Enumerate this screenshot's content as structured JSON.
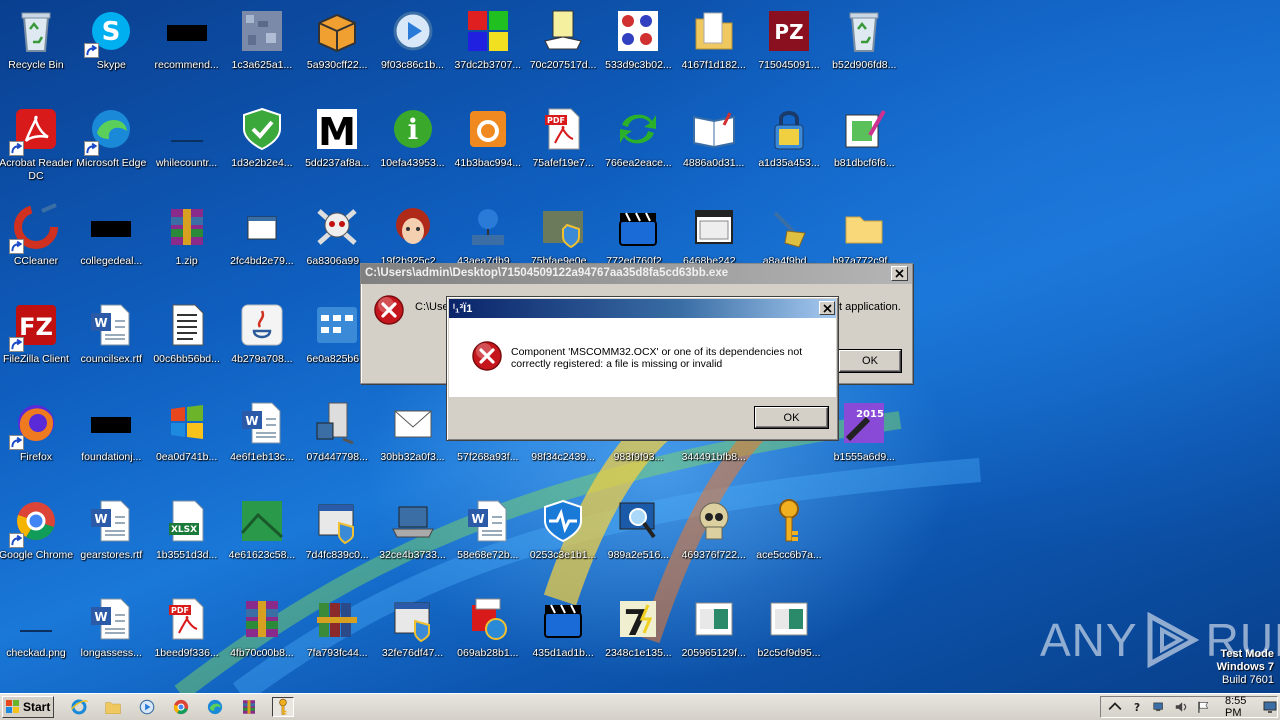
{
  "desktop": {
    "icons": [
      {
        "label": "Recycle Bin",
        "icon": "recycle-bin-icon",
        "shortcut": false
      },
      {
        "label": "Skype",
        "icon": "skype-icon",
        "shortcut": true
      },
      {
        "label": "recommend...",
        "icon": "black-file-icon",
        "shortcut": false
      },
      {
        "label": "1c3a625a1...",
        "icon": "noise-image-icon",
        "shortcut": false
      },
      {
        "label": "5a930cff22...",
        "icon": "package-box-icon",
        "shortcut": false
      },
      {
        "label": "9f03c86c1b...",
        "icon": "media-player-icon",
        "shortcut": false
      },
      {
        "label": "37dc2b3707...",
        "icon": "color-squares-icon",
        "shortcut": false
      },
      {
        "label": "70c207517d...",
        "icon": "clipboard-hand-icon",
        "shortcut": false
      },
      {
        "label": "533d9c3b02...",
        "icon": "pattern-icon",
        "shortcut": false
      },
      {
        "label": "4167f1d182...",
        "icon": "folder-icon",
        "shortcut": false
      },
      {
        "label": "715045091...",
        "icon": "pz-logo-icon",
        "shortcut": false
      },
      {
        "label": "b52d906fd8...",
        "icon": "recycle-bin-icon",
        "shortcut": false
      },
      {
        "label": "Acrobat Reader DC",
        "icon": "acrobat-icon",
        "shortcut": true
      },
      {
        "label": "Microsoft Edge",
        "icon": "edge-icon",
        "shortcut": true
      },
      {
        "label": "whilecountr...",
        "icon": "blue-file-icon",
        "shortcut": false
      },
      {
        "label": "1d3e2b2e4...",
        "icon": "shield-check-icon",
        "shortcut": false
      },
      {
        "label": "5dd237af8a...",
        "icon": "black-m-icon",
        "shortcut": false
      },
      {
        "label": "10efa43953...",
        "icon": "info-icon",
        "shortcut": false
      },
      {
        "label": "41b3bac994...",
        "icon": "orange-box-icon",
        "shortcut": false
      },
      {
        "label": "75afef19e7...",
        "icon": "pdf-icon",
        "shortcut": false
      },
      {
        "label": "766ea2eace...",
        "icon": "green-arrows-icon",
        "shortcut": false
      },
      {
        "label": "4886a0d31...",
        "icon": "open-book-icon",
        "shortcut": false
      },
      {
        "label": "a1d35a453...",
        "icon": "lock-icon",
        "shortcut": false
      },
      {
        "label": "b81dbcf6f6...",
        "icon": "picture-edit-icon",
        "shortcut": false
      },
      {
        "label": "CCleaner",
        "icon": "ccleaner-icon",
        "shortcut": true
      },
      {
        "label": "collegedeal...",
        "icon": "black-file-icon",
        "shortcut": false
      },
      {
        "label": "1.zip",
        "icon": "winrar-icon",
        "shortcut": false
      },
      {
        "label": "2fc4bd2e79...",
        "icon": "small-window-icon",
        "shortcut": false
      },
      {
        "label": "6a8306a99...",
        "icon": "skull-crossbones-icon",
        "shortcut": false
      },
      {
        "label": "19f2b925c2...",
        "icon": "anime-face-icon",
        "shortcut": false
      },
      {
        "label": "43aea7db9...",
        "icon": "globe-network-icon",
        "shortcut": false
      },
      {
        "label": "75bfae9e0e...",
        "icon": "setup-shield-icon",
        "shortcut": false
      },
      {
        "label": "772ed760f2...",
        "icon": "clapperboard-icon",
        "shortcut": false
      },
      {
        "label": "6468be242...",
        "icon": "window-icon",
        "shortcut": false
      },
      {
        "label": "a8a4f9bd...",
        "icon": "broom-icon",
        "shortcut": false
      },
      {
        "label": "b97a772c9f...",
        "icon": "folder-light-icon",
        "shortcut": false
      },
      {
        "label": "FileZilla Client",
        "icon": "filezilla-icon",
        "shortcut": true
      },
      {
        "label": "councilsex.rtf",
        "icon": "word-doc-icon",
        "shortcut": false
      },
      {
        "label": "00c6bb56bd...",
        "icon": "text-doc-icon",
        "shortcut": false
      },
      {
        "label": "4b279a708...",
        "icon": "java-icon",
        "shortcut": false
      },
      {
        "label": "6e0a825b6...",
        "icon": "calculator-window-icon",
        "shortcut": false
      },
      {
        "label": "Firefox",
        "icon": "firefox-icon",
        "shortcut": true
      },
      {
        "label": "foundationj...",
        "icon": "black-file-icon",
        "shortcut": false
      },
      {
        "label": "0ea0d741b...",
        "icon": "windows-logo-icon",
        "shortcut": false
      },
      {
        "label": "4e6f1eb13c...",
        "icon": "word-doc-icon",
        "shortcut": false
      },
      {
        "label": "07d447798...",
        "icon": "computer-tower-icon",
        "shortcut": false
      },
      {
        "label": "30bb32a0f3...",
        "icon": "envelope-icon",
        "shortcut": false
      },
      {
        "label": "57f268a93f...",
        "icon": "dark-file-icon",
        "shortcut": false
      },
      {
        "label": "98f34c2439...",
        "icon": "dark-file-icon",
        "shortcut": false
      },
      {
        "label": "983f9f93...",
        "icon": "dark-file-icon",
        "shortcut": false
      },
      {
        "label": "344491bfb8...",
        "icon": "dark-file-icon",
        "shortcut": false
      },
      {
        "label": "b1555a6d9...",
        "icon": "brush-2015-icon",
        "shortcut": false
      },
      {
        "label": "Google Chrome",
        "icon": "chrome-icon",
        "shortcut": true
      },
      {
        "label": "gearstores.rtf",
        "icon": "word-doc-icon",
        "shortcut": false
      },
      {
        "label": "1b3551d3d...",
        "icon": "xlsx-icon",
        "shortcut": false
      },
      {
        "label": "4e61623c58...",
        "icon": "green-image-icon",
        "shortcut": false
      },
      {
        "label": "7d4fc839c0...",
        "icon": "setup-window-icon",
        "shortcut": false
      },
      {
        "label": "32ce4b3733...",
        "icon": "laptop-icon",
        "shortcut": false
      },
      {
        "label": "58e68e72b...",
        "icon": "word-doc-icon",
        "shortcut": false
      },
      {
        "label": "0253c3e1b1...",
        "icon": "shield-pulse-icon",
        "shortcut": false
      },
      {
        "label": "989a2e516...",
        "icon": "monitor-magnifier-icon",
        "shortcut": false
      },
      {
        "label": "469376f722...",
        "icon": "skull-icon",
        "shortcut": false
      },
      {
        "label": "ace5cc6b7a...",
        "icon": "key-icon",
        "shortcut": false
      },
      {
        "label": "checkad.png",
        "icon": "blue-file-icon",
        "shortcut": false
      },
      {
        "label": "longassess...",
        "icon": "word-doc-icon",
        "shortcut": false
      },
      {
        "label": "1beed9f336...",
        "icon": "pdf-icon",
        "shortcut": false
      },
      {
        "label": "4fb70c00b8...",
        "icon": "winrar-icon",
        "shortcut": false
      },
      {
        "label": "7fa793fc44...",
        "icon": "books-icon",
        "shortcut": false
      },
      {
        "label": "32fe76df47...",
        "icon": "setup-window-icon",
        "shortcut": false
      },
      {
        "label": "069ab28b1...",
        "icon": "installer-icon",
        "shortcut": false
      },
      {
        "label": "435d1ad1b...",
        "icon": "clapperboard-icon",
        "shortcut": false
      },
      {
        "label": "2348c1e135...",
        "icon": "seven-zip-icon",
        "shortcut": false
      },
      {
        "label": "205965129f...",
        "icon": "photo-frame-icon",
        "shortcut": false
      },
      {
        "label": "b2c5cf9d95...",
        "icon": "photo-frame-icon",
        "shortcut": false
      }
    ]
  },
  "window_back": {
    "title": "C:\\Users\\admin\\Desktop\\71504509122a94767aa35d8fa5cd63bb.exe",
    "message_start": "C:\\Use",
    "message_end": "t application.",
    "ok_label": "OK",
    "icon": "error-icon"
  },
  "window_front": {
    "title": "ⁱ₁³Ï1",
    "message": "Component 'MSCOMM32.OCX' or one of its dependencies not correctly registered: a file is missing or invalid",
    "ok_label": "OK",
    "icon": "error-icon"
  },
  "watermark": {
    "text": "ANY",
    "text2": "RUN"
  },
  "test_mode": {
    "line1": "Test Mode",
    "line2": "Windows 7",
    "line3": "Build 7601"
  },
  "taskbar": {
    "start_label": "Start",
    "pinned": [
      "ie-icon",
      "explorer-icon",
      "media-player-icon",
      "chrome-icon",
      "edge-icon",
      "winrar-icon",
      "key-icon"
    ],
    "tray_icons": [
      "chevron-up-icon",
      "question-icon",
      "network-icon",
      "volume-icon",
      "flag-icon"
    ],
    "clock": "8:55 PM"
  },
  "colors": {
    "accent": "#0a246a",
    "desktop": "#1565c0",
    "error": "#c4161c"
  }
}
